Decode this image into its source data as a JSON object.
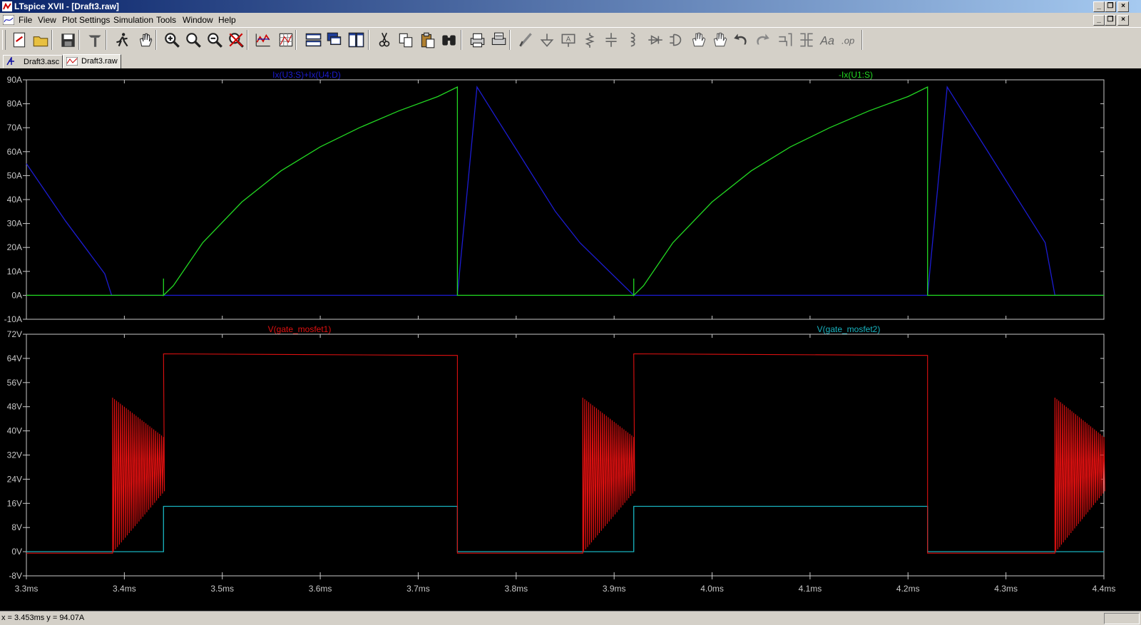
{
  "window": {
    "title": "LTspice XVII - [Draft3.raw]"
  },
  "menu": [
    "File",
    "View",
    "Plot Settings",
    "Simulation",
    "Tools",
    "Window",
    "Help"
  ],
  "toolbar": {
    "icons": [
      "new-schematic-icon",
      "open-icon",
      "save-icon",
      "control-panel-icon",
      "run-icon",
      "halt-icon",
      "zoom-in-icon",
      "zoom-area-icon",
      "zoom-out-icon",
      "zoom-fit-icon",
      "autorange-icon",
      "grid-icon",
      "tile-horizontal-icon",
      "cascade-icon",
      "tile-vertical-icon",
      "cut-icon",
      "copy-icon",
      "paste-icon",
      "find-icon",
      "print-icon",
      "print-setup-icon",
      "wire-icon",
      "ground-icon",
      "label-icon",
      "resistor-icon",
      "capacitor-icon",
      "inductor-icon",
      "diode-icon",
      "component-icon",
      "move-icon",
      "drag-icon",
      "undo-icon",
      "redo-icon",
      "rotate-icon",
      "mirror-icon",
      "text-icon",
      "spice-directive-icon"
    ]
  },
  "tabs": [
    {
      "label": "Draft3.asc",
      "icon": "schematic-icon"
    },
    {
      "label": "Draft3.raw",
      "icon": "waveform-icon"
    }
  ],
  "status": {
    "readout": "x = 3.453ms    y = 94.07A"
  },
  "chart_data": [
    {
      "type": "line",
      "pane": "top",
      "xlabel": "",
      "ylabel": "",
      "xlim": [
        3.3,
        4.4
      ],
      "ylim": [
        -10,
        90
      ],
      "yticks": [
        "90A",
        "80A",
        "70A",
        "60A",
        "50A",
        "40A",
        "30A",
        "20A",
        "10A",
        "0A",
        "-10A"
      ],
      "ytick_values": [
        90,
        80,
        70,
        60,
        50,
        40,
        30,
        20,
        10,
        0,
        -10
      ],
      "series": [
        {
          "name": "Ix(U3:S)+Ix(U4:D)",
          "color": "#1c1cd2",
          "x": [
            3.3,
            3.32,
            3.34,
            3.36,
            3.38,
            3.387,
            3.44,
            3.74,
            3.76,
            3.78,
            3.8,
            3.82,
            3.84,
            3.865,
            3.92,
            4.22,
            4.24,
            4.26,
            4.28,
            4.3,
            4.32,
            4.34,
            4.35,
            4.4
          ],
          "y": [
            55,
            43,
            31,
            20,
            9,
            0,
            0,
            0,
            87,
            74,
            61,
            48,
            35,
            22,
            0,
            0,
            87,
            74,
            61,
            48,
            35,
            22,
            0,
            0
          ]
        },
        {
          "name": "-Ix(U1:S)",
          "color": "#22d822",
          "x": [
            3.3,
            3.44,
            3.44,
            3.44,
            3.45,
            3.48,
            3.52,
            3.56,
            3.6,
            3.64,
            3.68,
            3.72,
            3.74,
            3.74,
            3.92,
            3.92,
            3.92,
            3.93,
            3.96,
            4.0,
            4.04,
            4.08,
            4.12,
            4.16,
            4.2,
            4.22,
            4.22,
            4.4
          ],
          "y": [
            0,
            0,
            7,
            0,
            4,
            22,
            39,
            52,
            62,
            70,
            77,
            83,
            87,
            0,
            0,
            7,
            0,
            4,
            22,
            39,
            52,
            62,
            70,
            77,
            83,
            87,
            0,
            0
          ]
        }
      ]
    },
    {
      "type": "line",
      "pane": "bottom",
      "xlabel": "",
      "ylabel": "",
      "xlim": [
        3.3,
        4.4
      ],
      "ylim": [
        -8,
        72
      ],
      "yticks": [
        "72V",
        "64V",
        "56V",
        "48V",
        "40V",
        "32V",
        "24V",
        "16V",
        "8V",
        "0V",
        "-8V"
      ],
      "ytick_values": [
        72,
        64,
        56,
        48,
        40,
        32,
        24,
        16,
        8,
        0,
        -8
      ],
      "xticks": [
        "3.3ms",
        "3.4ms",
        "3.5ms",
        "3.6ms",
        "3.7ms",
        "3.8ms",
        "3.9ms",
        "4.0ms",
        "4.1ms",
        "4.2ms",
        "4.3ms",
        "4.4ms"
      ],
      "xtick_values": [
        3.3,
        3.4,
        3.5,
        3.6,
        3.7,
        3.8,
        3.9,
        4.0,
        4.1,
        4.2,
        4.3,
        4.4
      ],
      "series": [
        {
          "name": "V(gate_mosfet1)",
          "color": "#e01010",
          "segments": [
            {
              "kind": "flat",
              "x": [
                3.3,
                3.388
              ],
              "y": -0.5
            },
            {
              "kind": "ring",
              "x": [
                3.388,
                3.44
              ],
              "peak_start": 51,
              "peak_end": 38,
              "low_start": 0,
              "low_end": 20
            },
            {
              "kind": "pulse",
              "x": [
                3.44,
                3.74
              ],
              "y_start": 65.5,
              "y_end": 65
            },
            {
              "kind": "flat",
              "x": [
                3.74,
                3.868
              ],
              "y": -0.5
            },
            {
              "kind": "ring",
              "x": [
                3.868,
                3.92
              ],
              "peak_start": 51,
              "peak_end": 38,
              "low_start": 0,
              "low_end": 20
            },
            {
              "kind": "pulse",
              "x": [
                3.92,
                4.22
              ],
              "y_start": 65.5,
              "y_end": 65
            },
            {
              "kind": "flat",
              "x": [
                4.22,
                4.35
              ],
              "y": -0.5
            },
            {
              "kind": "ring",
              "x": [
                4.35,
                4.4
              ],
              "peak_start": 51,
              "peak_end": 38,
              "low_start": 0,
              "low_end": 20
            }
          ]
        },
        {
          "name": "V(gate_mosfet2)",
          "color": "#19b4c0",
          "x": [
            3.3,
            3.44,
            3.44,
            3.74,
            3.74,
            3.92,
            3.92,
            4.22,
            4.22,
            4.4
          ],
          "y": [
            0,
            0,
            15,
            15,
            0,
            0,
            15,
            15,
            0,
            0
          ]
        }
      ]
    }
  ]
}
